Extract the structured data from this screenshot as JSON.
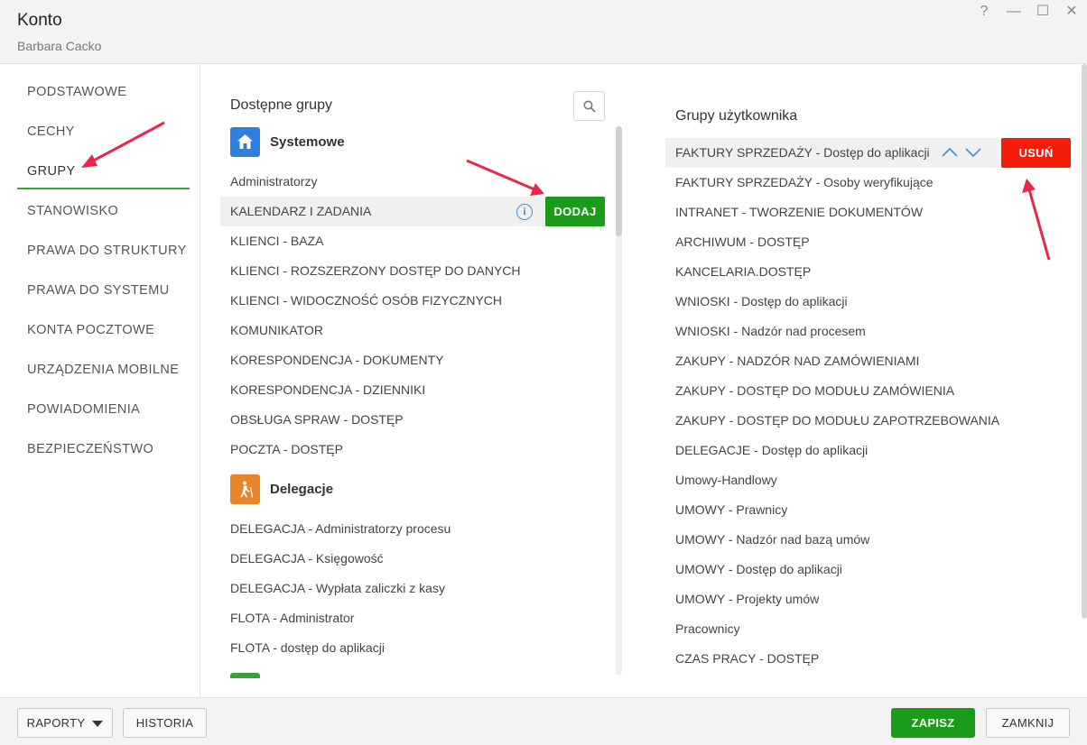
{
  "window": {
    "title": "Konto",
    "subtitle": "Barbara Cacko",
    "controls": {
      "help": "?",
      "minimize": "—",
      "maximize": "☐",
      "close": "✕"
    }
  },
  "nav": {
    "items": [
      {
        "label": "PODSTAWOWE",
        "active": false
      },
      {
        "label": "CECHY",
        "active": false
      },
      {
        "label": "GRUPY",
        "active": true
      },
      {
        "label": "STANOWISKO",
        "active": false
      },
      {
        "label": "PRAWA DO STRUKTURY",
        "active": false
      },
      {
        "label": "PRAWA DO SYSTEMU",
        "active": false
      },
      {
        "label": "KONTA POCZTOWE",
        "active": false
      },
      {
        "label": "URZĄDZENIA MOBILNE",
        "active": false
      },
      {
        "label": "POWIADOMIENIA",
        "active": false
      },
      {
        "label": "BEZPIECZEŃSTWO",
        "active": false
      }
    ],
    "accent_color": "#3aa335"
  },
  "available": {
    "title": "Dostępne grupy",
    "search_icon": "search-icon",
    "groups": [
      {
        "name": "Systemowe",
        "icon": "home-icon",
        "icon_color": "#2f7fe0",
        "items": [
          "Administratorzy",
          "KALENDARZ I ZADANIA",
          "KLIENCI - BAZA",
          "KLIENCI - ROZSZERZONY DOSTĘP DO DANYCH",
          "KLIENCI - WIDOCZNOŚĆ OSÓB FIZYCZNYCH",
          "KOMUNIKATOR",
          "KORESPONDENCJA - DOKUMENTY",
          "KORESPONDENCJA - DZIENNIKI",
          "OBSŁUGA SPRAW - DOSTĘP",
          "POCZTA - DOSTĘP"
        ]
      },
      {
        "name": "Delegacje",
        "icon": "traveler-icon",
        "icon_color": "#e8842a",
        "items": [
          "DELEGACJA - Administratorzy procesu",
          "DELEGACJA - Księgowość",
          "DELEGACJA - Wypłata zaliczki z kasy",
          "FLOTA - Administrator",
          "FLOTA - dostęp do aplikacji"
        ]
      }
    ],
    "highlighted_item": "KALENDARZ I ZADANIA",
    "info_glyph": "i",
    "add_label": "DODAJ",
    "add_color": "#1a9b1a"
  },
  "user_groups": {
    "title": "Grupy użytkownika",
    "items": [
      "FAKTURY SPRZEDAŻY - Dostęp do aplikacji",
      "FAKTURY SPRZEDAŻY - Osoby weryfikujące",
      "INTRANET - TWORZENIE DOKUMENTÓW",
      "ARCHIWUM - DOSTĘP",
      "KANCELARIA.DOSTĘP",
      "WNIOSKI - Dostęp do aplikacji",
      "WNIOSKI - Nadzór nad procesem",
      "ZAKUPY - NADZÓR NAD ZAMÓWIENIAMI",
      "ZAKUPY - DOSTĘP DO MODUŁU ZAMÓWIENIA",
      "ZAKUPY - DOSTĘP DO MODUŁU ZAPOTRZEBOWANIA",
      "DELEGACJE - Dostęp do aplikacji",
      "Umowy-Handlowy",
      "UMOWY - Prawnicy",
      "UMOWY - Nadzór nad bazą umów",
      "UMOWY - Dostęp do aplikacji",
      "UMOWY - Projekty umów",
      "Pracownicy",
      "CZAS PRACY - DOSTĘP"
    ],
    "highlighted_item": "FAKTURY SPRZEDAŻY - Dostęp do aplikacji",
    "delete_label": "USUŃ",
    "delete_color": "#f51c0c",
    "move_up_icon": "chevron-up-icon",
    "move_down_icon": "chevron-down-icon"
  },
  "footer": {
    "reports_label": "RAPORTY",
    "history_label": "HISTORIA",
    "save_label": "ZAPISZ",
    "close_label": "ZAMKNIJ",
    "save_color": "#1a9b1a"
  },
  "annotations": {
    "arrow_color": "#e8284a"
  }
}
